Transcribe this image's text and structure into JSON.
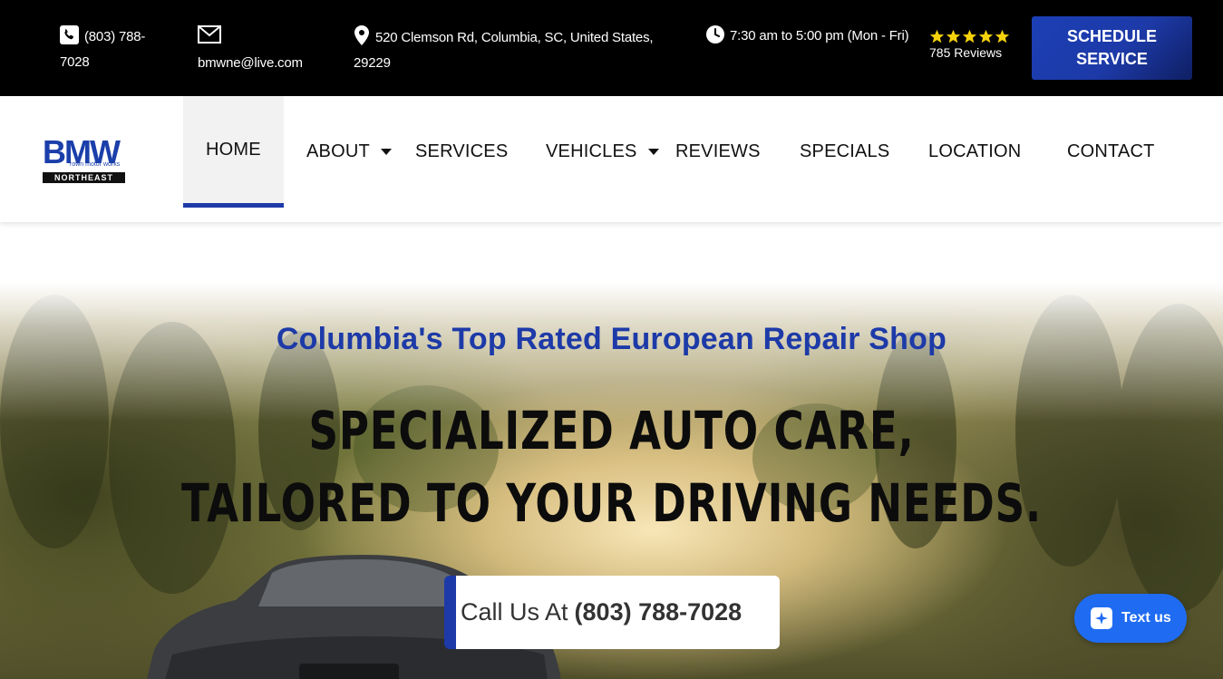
{
  "topbar": {
    "phone": "(803) 788-7028",
    "email": "bmwne@live.com",
    "address": "520 Clemson Rd, Columbia, SC, United States, 29229",
    "hours": "7:30 am to 5:00 pm (Mon - Fri)",
    "rating_stars": 5,
    "reviews": "785 Reviews",
    "schedule_label": "SCHEDULE SERVICE",
    "star_color": "#f5d20c"
  },
  "logo": {
    "big": "BMW",
    "small": "rown motor works",
    "bar": "NORTHEAST"
  },
  "nav": {
    "items": [
      {
        "label": "HOME"
      },
      {
        "label": "ABOUT"
      },
      {
        "label": "SERVICES"
      },
      {
        "label": "VEHICLES"
      },
      {
        "label": "REVIEWS"
      },
      {
        "label": "SPECIALS"
      },
      {
        "label": "LOCATION"
      },
      {
        "label": "CONTACT"
      }
    ],
    "active_color": "#1d3aa8"
  },
  "hero": {
    "subtitle": "Columbia's Top Rated European Repair Shop",
    "title_line1": "Specialized Auto Care,",
    "title_line2": "Tailored to Your Driving Needs.",
    "call_prefix": "Call Us At",
    "call_number": "(803) 788-7028"
  },
  "widget": {
    "text_us": "Text us",
    "color": "#1f6cf2"
  }
}
